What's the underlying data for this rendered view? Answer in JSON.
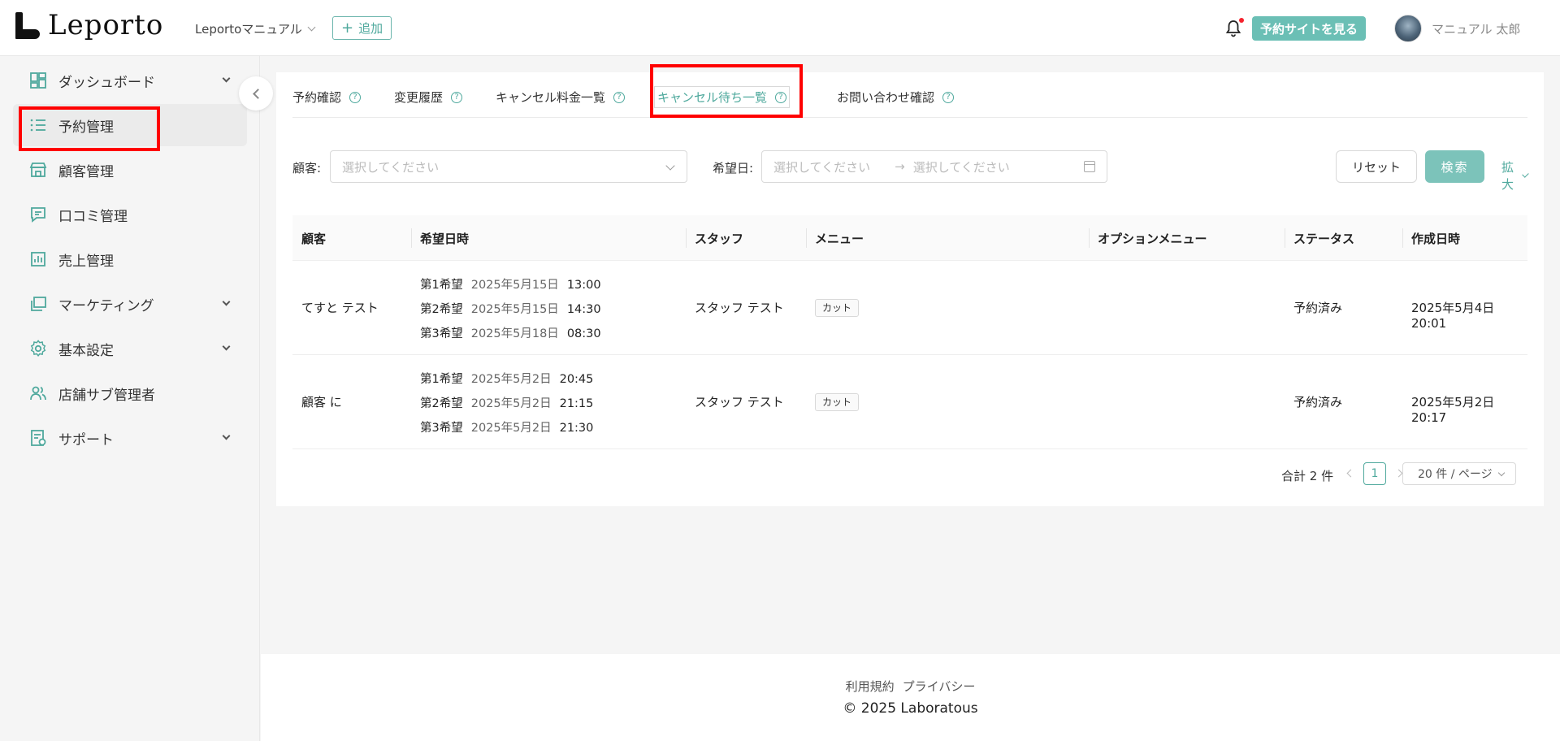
{
  "header": {
    "logo_text": "Leporto",
    "store_name": "Leportoマニュアル",
    "add_label": "追加",
    "site_button": "予約サイトを見る",
    "user_name": "マニュアル 太郎"
  },
  "sidebar": {
    "items": [
      {
        "label": "ダッシュボード",
        "icon": "dashboard-icon"
      },
      {
        "label": "予約管理",
        "icon": "list-icon"
      },
      {
        "label": "顧客管理",
        "icon": "store-icon"
      },
      {
        "label": "口コミ管理",
        "icon": "comment-icon"
      },
      {
        "label": "売上管理",
        "icon": "chart-icon"
      },
      {
        "label": "マーケティング",
        "icon": "copy-icon"
      },
      {
        "label": "基本設定",
        "icon": "gear-icon"
      },
      {
        "label": "店舗サブ管理者",
        "icon": "users-icon"
      },
      {
        "label": "サポート",
        "icon": "document-icon"
      }
    ]
  },
  "tabs": [
    {
      "label": "予約確認"
    },
    {
      "label": "変更履歴"
    },
    {
      "label": "キャンセル料金一覧"
    },
    {
      "label": "キャンセル待ち一覧"
    },
    {
      "label": "お問い合わせ確認"
    }
  ],
  "filters": {
    "customer_label": "顧客:",
    "customer_placeholder": "選択してください",
    "date_label": "希望日:",
    "date_start_placeholder": "選択してください",
    "date_end_placeholder": "選択してください",
    "reset_label": "リセット",
    "search_label": "検索",
    "expand_label": "拡大"
  },
  "table": {
    "columns": [
      "顧客",
      "希望日時",
      "スタッフ",
      "メニュー",
      "オプションメニュー",
      "ステータス",
      "作成日時"
    ],
    "rows": [
      {
        "customer": "てすと テスト",
        "prefs": [
          {
            "label": "第1希望",
            "date": "2025年5月15日",
            "time": "13:00"
          },
          {
            "label": "第2希望",
            "date": "2025年5月15日",
            "time": "14:30"
          },
          {
            "label": "第3希望",
            "date": "2025年5月18日",
            "time": "08:30"
          }
        ],
        "staff": "スタッフ テスト",
        "menu": "カット",
        "option_menu": "",
        "status": "予約済み",
        "created": "2025年5月4日 20:01"
      },
      {
        "customer": "顧客 に",
        "prefs": [
          {
            "label": "第1希望",
            "date": "2025年5月2日",
            "time": "20:45"
          },
          {
            "label": "第2希望",
            "date": "2025年5月2日",
            "time": "21:15"
          },
          {
            "label": "第3希望",
            "date": "2025年5月2日",
            "time": "21:30"
          }
        ],
        "staff": "スタッフ テスト",
        "menu": "カット",
        "option_menu": "",
        "status": "予約済み",
        "created": "2025年5月2日 20:17"
      }
    ]
  },
  "pagination": {
    "total": "合計 2 件",
    "current_page": "1",
    "page_size": "20 件 / ページ"
  },
  "footer": {
    "terms": "利用規約",
    "privacy": "プライバシー",
    "copyright": "© 2025 Laboratous"
  },
  "colors": {
    "accent": "#4fa99d",
    "primary_button": "#6bbfb5",
    "highlight": "#ff0000"
  }
}
